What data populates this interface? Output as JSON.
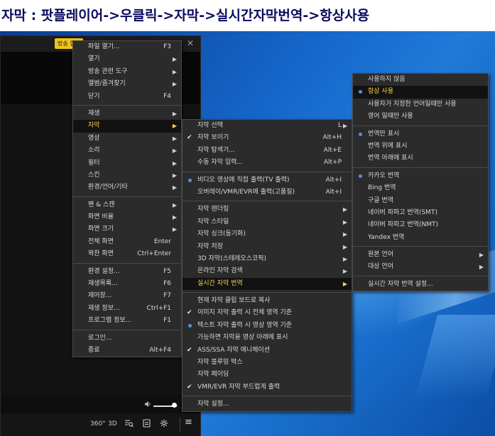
{
  "caption": "자막  : 팟플레이어->우클릭->자막->실시간자막번역->항상사용",
  "player": {
    "badge": "방송 캡처",
    "min_glyph": "—",
    "close_glyph": "✕",
    "controls": {
      "btn_360": "360°",
      "btn_3d": "3D",
      "menu_glyph": "≡"
    },
    "volume_level": 0.85
  },
  "main_menu": [
    {
      "label": "파일 열기...",
      "shortcut": "F3"
    },
    {
      "label": "열기",
      "submenu": true
    },
    {
      "label": "방송 관련 도구",
      "submenu": true
    },
    {
      "label": "앨범/즐겨찾기",
      "submenu": true
    },
    {
      "label": "닫기",
      "shortcut": "F4"
    },
    {
      "sep": true
    },
    {
      "label": "재생",
      "submenu": true
    },
    {
      "label": "자막",
      "submenu": true,
      "highlight": true
    },
    {
      "label": "영상",
      "submenu": true
    },
    {
      "label": "소리",
      "submenu": true
    },
    {
      "label": "필터",
      "submenu": true
    },
    {
      "label": "스킨",
      "submenu": true
    },
    {
      "label": "환경/언어/기타",
      "submenu": true
    },
    {
      "sep": true
    },
    {
      "label": "팬 & 스캔",
      "submenu": true
    },
    {
      "label": "화면 비율",
      "submenu": true
    },
    {
      "label": "화면 크기",
      "submenu": true
    },
    {
      "label": "전체 화면",
      "shortcut": "Enter"
    },
    {
      "label": "꽉찬 화면",
      "shortcut": "Ctrl+Enter"
    },
    {
      "sep": true
    },
    {
      "label": "환경 설정...",
      "shortcut": "F5"
    },
    {
      "label": "재생목록...",
      "shortcut": "F6"
    },
    {
      "label": "제어창...",
      "shortcut": "F7"
    },
    {
      "label": "재생 정보...",
      "shortcut": "Ctrl+F1"
    },
    {
      "label": "프로그램 정보...",
      "shortcut": "F1"
    },
    {
      "sep": true
    },
    {
      "label": "로그인..."
    },
    {
      "label": "종료",
      "shortcut": "Alt+F4"
    }
  ],
  "subtitle_menu": [
    {
      "label": "자막 선택",
      "shortcut": "L",
      "submenu": true
    },
    {
      "label": "자막 보이기",
      "shortcut": "Alt+H",
      "check": true
    },
    {
      "label": "자막 탐색기...",
      "shortcut": "Alt+E"
    },
    {
      "label": "수동 자막 입력...",
      "shortcut": "Alt+P"
    },
    {
      "sep": true
    },
    {
      "label": "비디오 영상에 직접 출력(TV 출력)",
      "shortcut": "Alt+I",
      "radio": true
    },
    {
      "label": "오버레이/VMR/EVR에 출력(고품질)",
      "shortcut": "Alt+I"
    },
    {
      "sep": true
    },
    {
      "label": "자막 렌더링",
      "submenu": true
    },
    {
      "label": "자막 스타일",
      "submenu": true
    },
    {
      "label": "자막 싱크(동기화)",
      "submenu": true
    },
    {
      "label": "자막 저장",
      "submenu": true
    },
    {
      "label": "3D 자막(스테레오스코픽)",
      "submenu": true
    },
    {
      "label": "온라인 자막 검색",
      "submenu": true
    },
    {
      "label": "실시간 자막 번역",
      "submenu": true,
      "highlight": true
    },
    {
      "sep": true
    },
    {
      "label": "현재 자막 클립 보드로 복사"
    },
    {
      "label": "이미지 자막 출력 시 전체 영역 기준",
      "check": true
    },
    {
      "label": "텍스트 자막 출력 시 영상 영역 기준",
      "radio": true
    },
    {
      "label": "가능하면 자막을 영상 아래에 표시"
    },
    {
      "label": "ASS/SSA 자막 애니메이션",
      "check": true
    },
    {
      "label": "자막 블루밍 박스"
    },
    {
      "label": "자막 페이딩"
    },
    {
      "label": "VMR/EVR 자막 부드럽게 출력",
      "check": true
    },
    {
      "sep": true
    },
    {
      "label": "자막 설정..."
    }
  ],
  "translate_menu": [
    {
      "label": "사용하지 않음"
    },
    {
      "label": "항상 사용",
      "radio": true,
      "highlight": true
    },
    {
      "label": "사용자가 지정한 언어일때만 사용"
    },
    {
      "label": "영어 일때만 사용"
    },
    {
      "sep": true
    },
    {
      "label": "번역만 표시",
      "radio": true
    },
    {
      "label": "번역 위에 표시"
    },
    {
      "label": "번역 아래에 표시"
    },
    {
      "sep": true
    },
    {
      "label": "카카오 번역",
      "radio": true
    },
    {
      "label": "Bing 번역"
    },
    {
      "label": "구글 번역"
    },
    {
      "label": "네이버 파파고 번역(SMT)"
    },
    {
      "label": "네이버 파파고 번역(NMT)"
    },
    {
      "label": "Yandex 번역"
    },
    {
      "sep": true
    },
    {
      "label": "원본 언어",
      "submenu": true
    },
    {
      "label": "대상 언어",
      "submenu": true
    },
    {
      "sep": true
    },
    {
      "label": "실시간 자막 번역 설정..."
    }
  ]
}
